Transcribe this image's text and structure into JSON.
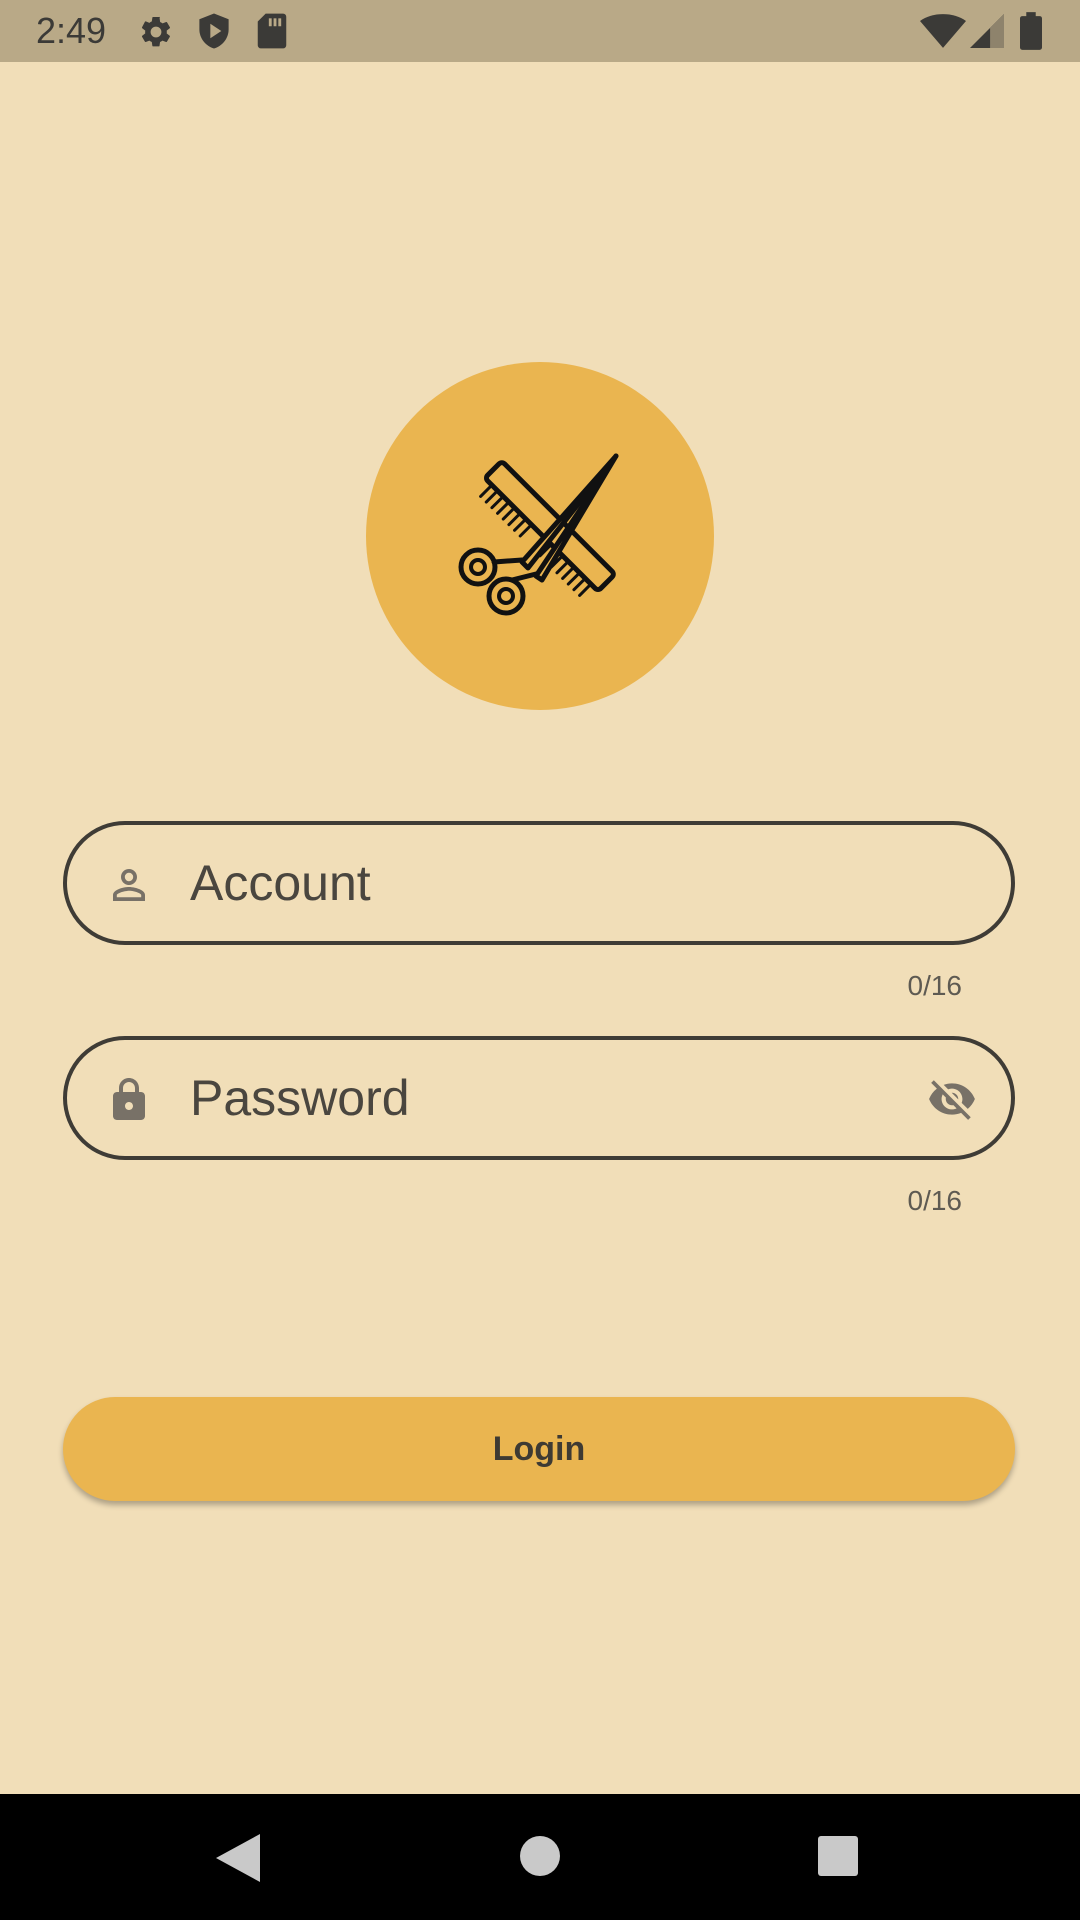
{
  "status_bar": {
    "time": "2:49",
    "left_icons": [
      "gear-icon",
      "shield-play-icon",
      "sd-card-icon"
    ],
    "right_icons": [
      "wifi-icon",
      "signal-icon",
      "battery-icon"
    ]
  },
  "logo": {
    "icon": "scissors-comb-icon",
    "color": "#eab550"
  },
  "form": {
    "account": {
      "placeholder": "Account",
      "value": "",
      "counter": "0/16",
      "icon": "person-icon"
    },
    "password": {
      "placeholder": "Password",
      "value": "",
      "counter": "0/16",
      "icon": "lock-icon",
      "toggle_icon": "eye-off-icon"
    },
    "login_label": "Login"
  },
  "colors": {
    "background": "#f1deb8",
    "accent": "#eab550",
    "status_bar": "#b9a987",
    "outline": "#3f3c36"
  },
  "nav_bar": {
    "icons": [
      "back-icon",
      "home-icon",
      "recents-icon"
    ]
  }
}
